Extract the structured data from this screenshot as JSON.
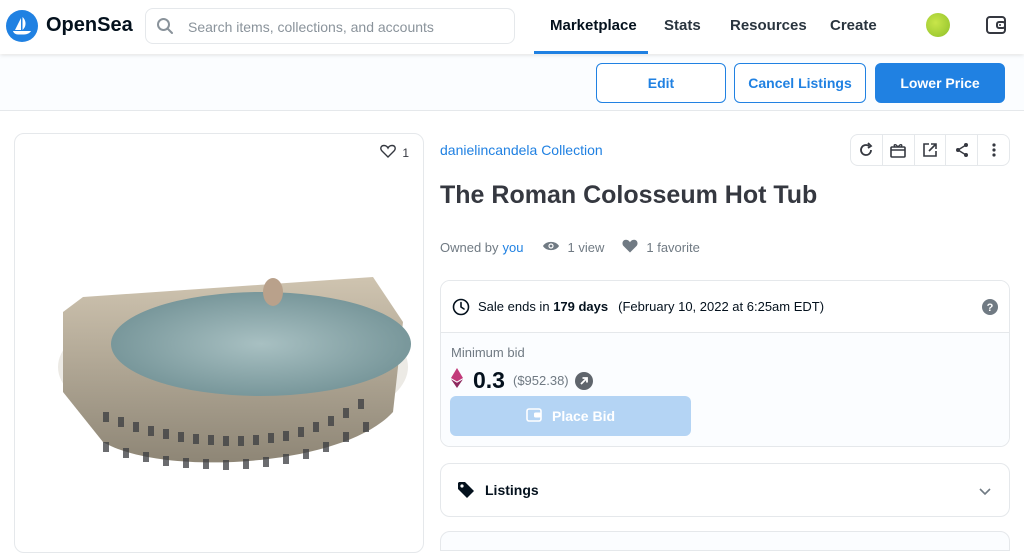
{
  "brand": {
    "name": "OpenSea",
    "logo_icon": "opensea-sailboat-icon",
    "color": "#2081e2"
  },
  "search": {
    "placeholder": "Search items, collections, and accounts"
  },
  "nav": {
    "items": [
      {
        "label": "Marketplace",
        "active": true
      },
      {
        "label": "Stats",
        "active": false
      },
      {
        "label": "Resources",
        "active": false
      },
      {
        "label": "Create",
        "active": false
      }
    ]
  },
  "actions": {
    "edit": "Edit",
    "cancel_listings": "Cancel Listings",
    "lower_price": "Lower Price"
  },
  "item": {
    "favorites_count": "1",
    "collection": "danielincandela Collection",
    "title": "The Roman Colosseum Hot Tub",
    "owned_by_prefix": "Owned by",
    "owner": "you",
    "views": "1 view",
    "favorites": "1 favorite"
  },
  "sale": {
    "ends_prefix": "Sale ends in",
    "ends_in": "179 days",
    "ends_date": "(February 10, 2022 at 6:25am EDT)",
    "min_bid_label": "Minimum bid",
    "price": "0.3",
    "usd": "($952.38)",
    "place_bid": "Place Bid"
  },
  "listings": {
    "title": "Listings"
  },
  "colors": {
    "accent": "#2081e2",
    "eth": "#c23a7a",
    "muted": "#707a83"
  }
}
